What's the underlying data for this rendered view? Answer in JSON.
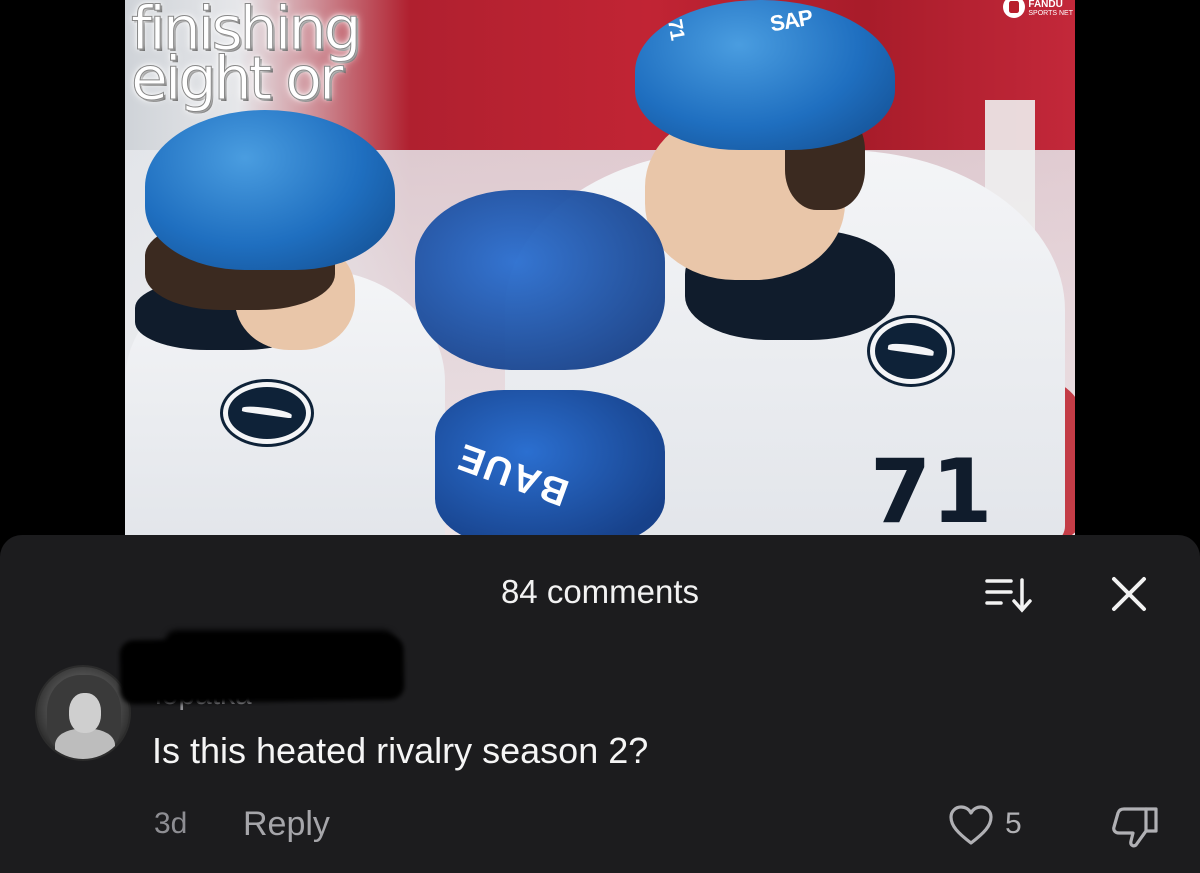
{
  "video": {
    "overlay_lines": [
      "finishing",
      "eight or"
    ],
    "brand_name": "FANDU",
    "brand_sub": "SPORTS NET",
    "helmet_sponsor": "SAP",
    "glove_brand": "BAUE",
    "jersey_number": "71",
    "helmet_number": "71"
  },
  "comments_panel": {
    "title": "84 comments",
    "sort_icon": "sort-icon",
    "close_icon": "close-icon"
  },
  "comment": {
    "username": "lopatka",
    "text": "Is this heated rivalry season 2?",
    "time": "3d",
    "reply_label": "Reply",
    "like_count": "5",
    "like_icon": "heart-outline-icon",
    "dislike_icon": "thumbs-down-icon"
  },
  "colors": {
    "sheet_background": "#1c1c1e",
    "primary_text": "#f5f5f5",
    "secondary_text": "#8e8e93"
  }
}
